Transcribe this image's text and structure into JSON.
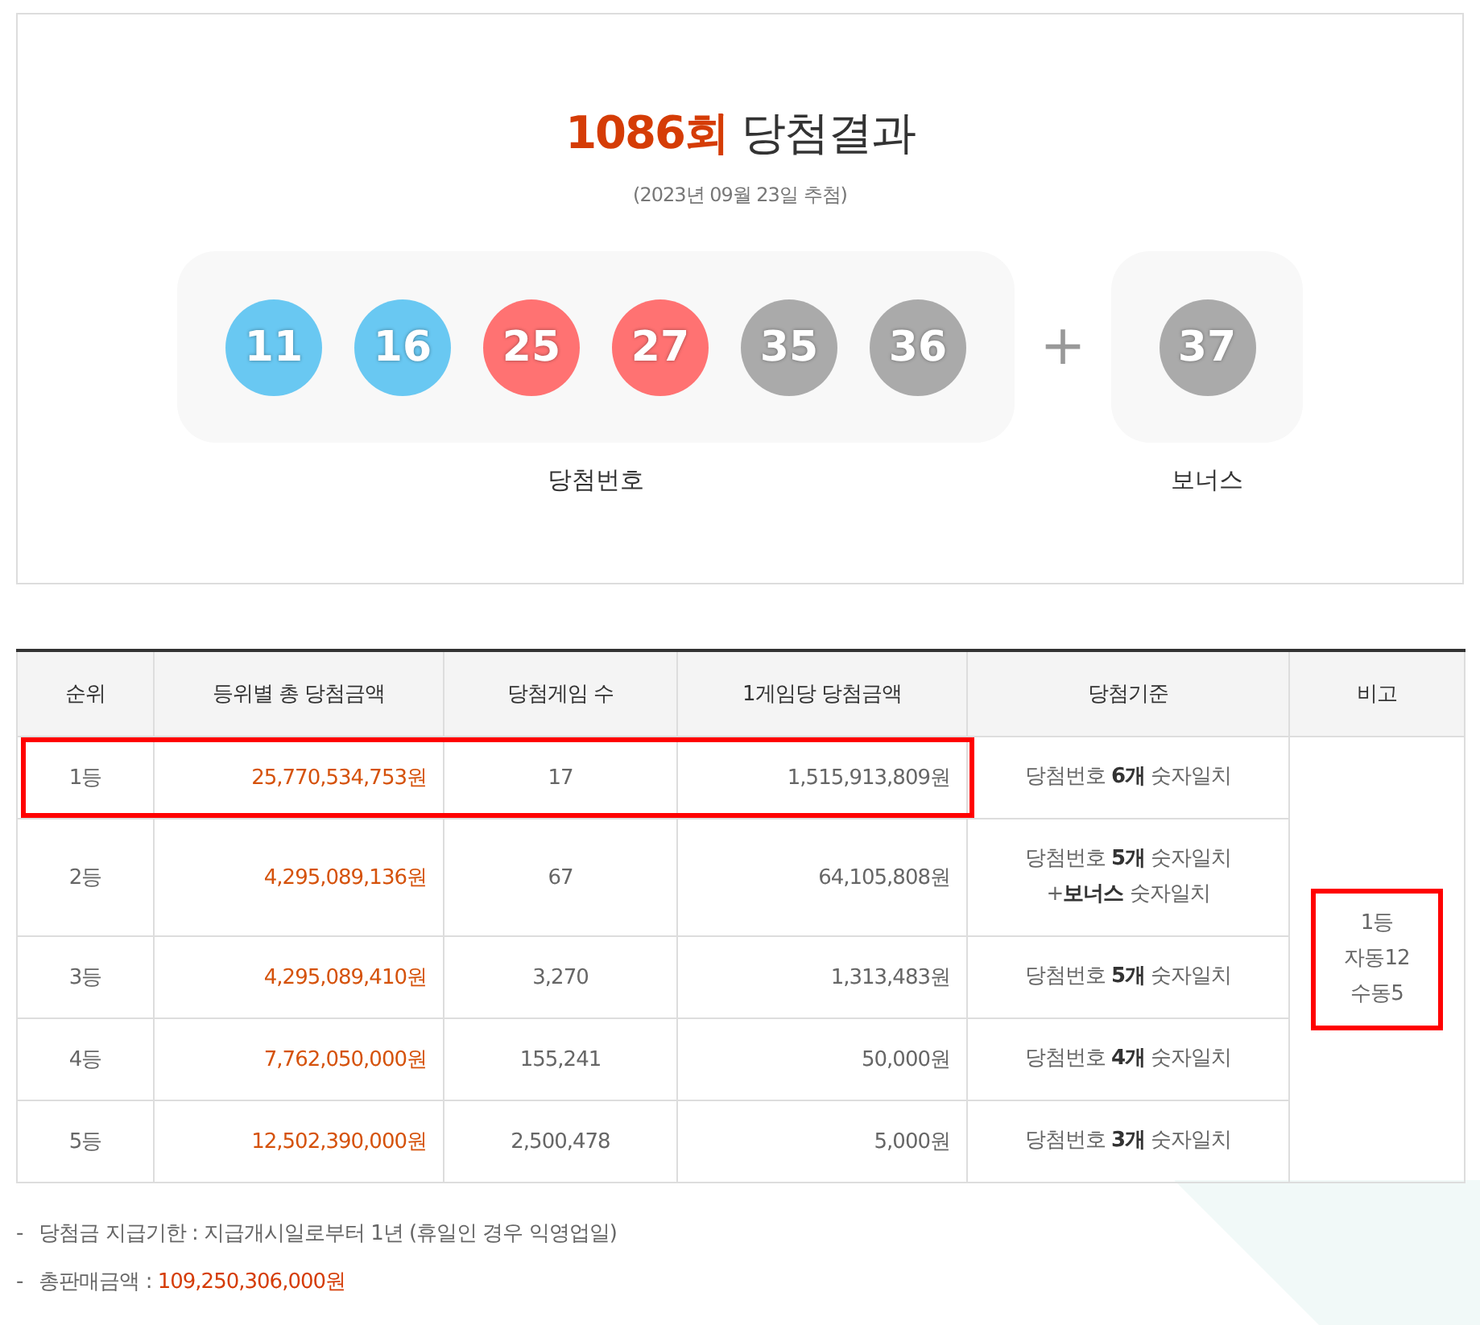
{
  "draw": {
    "round": "1086회",
    "title": "당첨결과",
    "date": "(2023년 09월 23일 추첨)",
    "numbers": [
      {
        "value": "11",
        "color": "#69c8f2"
      },
      {
        "value": "16",
        "color": "#69c8f2"
      },
      {
        "value": "25",
        "color": "#ff7272"
      },
      {
        "value": "27",
        "color": "#ff7272"
      },
      {
        "value": "35",
        "color": "#aaaaaa"
      },
      {
        "value": "36",
        "color": "#aaaaaa"
      }
    ],
    "plus": "+",
    "bonus": {
      "value": "37",
      "color": "#aaaaaa"
    },
    "numbers_label": "당첨번호",
    "bonus_label": "보너스"
  },
  "table": {
    "columns": [
      "순위",
      "등위별 총 당첨금액",
      "당첨게임 수",
      "1게임당 당첨금액",
      "당첨기준",
      "비고"
    ],
    "rows": [
      {
        "rank": "1등",
        "total": "25,770,534,753원",
        "winners": "17",
        "per_game": "1,515,913,809원",
        "criteria": "당첨번호 **6개** 숫자일치",
        "highlighted": true
      },
      {
        "rank": "2등",
        "total": "4,295,089,136원",
        "winners": "67",
        "per_game": "64,105,808원",
        "criteria": "당첨번호 **5개** 숫자일치\n+**보너스** 숫자일치",
        "highlighted": false
      },
      {
        "rank": "3등",
        "total": "4,295,089,410원",
        "winners": "3,270",
        "per_game": "1,313,483원",
        "criteria": "당첨번호 **5개** 숫자일치",
        "highlighted": false
      },
      {
        "rank": "4등",
        "total": "7,762,050,000원",
        "winners": "155,241",
        "per_game": "50,000원",
        "criteria": "당첨번호 **4개** 숫자일치",
        "highlighted": false
      },
      {
        "rank": "5등",
        "total": "12,502,390,000원",
        "winners": "2,500,478",
        "per_game": "5,000원",
        "criteria": "당첨번호 **3개** 숫자일치",
        "highlighted": false
      }
    ],
    "note": {
      "text": "1등\n자동12\n수동5",
      "highlighted": true
    }
  },
  "footer": [
    {
      "dash": "-",
      "label": "당첨금 지급기한 : 지급개시일로부터 1년 (휴일인 경우 익영업일)"
    },
    {
      "dash": "-",
      "label": "총판매금액 : ",
      "value": "109,250,306,000원"
    }
  ]
}
